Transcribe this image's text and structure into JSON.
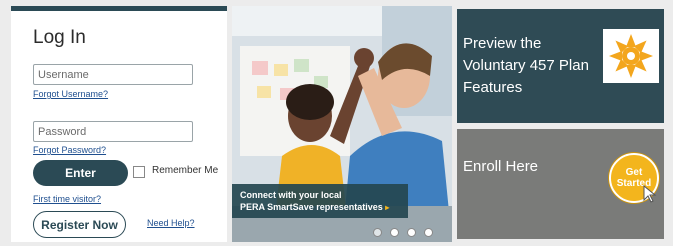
{
  "login": {
    "title": "Log In",
    "username_placeholder": "Username",
    "forgot_username": "Forgot Username?",
    "password_placeholder": "Password",
    "forgot_password": "Forgot Password?",
    "enter_label": "Enter",
    "remember_label": "Remember Me",
    "first_time": "First time visitor?",
    "register_label": "Register Now",
    "need_help": "Need Help?"
  },
  "hero": {
    "caption_line1": "Connect with your local",
    "caption_line2": "PERA SmartSave representatives",
    "caption_arrow": "▸",
    "slides": 4,
    "active_slide": 1
  },
  "tiles": {
    "preview_text": "Preview the Voluntary 457 Plan Features",
    "enroll_text": "Enroll Here",
    "get_started": "Get Started"
  },
  "colors": {
    "brand_dark": "#2b4a55",
    "accent_yellow": "#f3b51d",
    "enroll_gray": "#7a7b79",
    "link_blue": "#1f4f8f"
  }
}
